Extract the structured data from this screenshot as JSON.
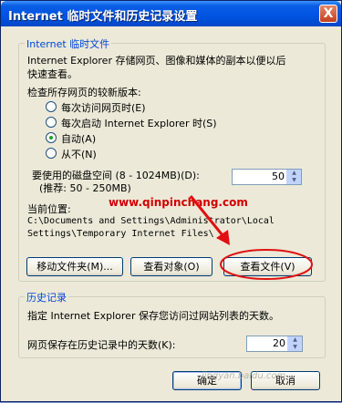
{
  "window": {
    "title": "Internet 临时文件和历史记录设置",
    "close_label": "X"
  },
  "temp_files": {
    "legend": "Internet 临时文件",
    "desc_line1": "Internet Explorer 存储网页、图像和媒体的副本以便以后",
    "desc_line2": "快速查看。",
    "check_label": "检查所存网页的较新版本:",
    "options": [
      {
        "label": "每次访问网页时(E)",
        "selected": false
      },
      {
        "label": "每次启动 Internet Explorer 时(S)",
        "selected": false
      },
      {
        "label": "自动(A)",
        "selected": true
      },
      {
        "label": "从不(N)",
        "selected": false
      }
    ],
    "disk_label_line1": "要使用的磁盘空间 (8 - 1024MB)(D):",
    "disk_label_line2": "(推荐: 50 - 250MB)",
    "disk_value": "50",
    "location_label": "当前位置:",
    "location_line1": "C:\\Documents and Settings\\Administrator\\Local",
    "location_line2": "Settings\\Temporary Internet Files\\",
    "buttons": {
      "move": "移动文件夹(M)...",
      "view_objects": "查看对象(O)",
      "view_files": "查看文件(V)"
    }
  },
  "history": {
    "legend": "历史记录",
    "desc": "指定 Internet Explorer 保存您访问过网站列表的天数。",
    "days_label": "网页保存在历史记录中的天数(K):",
    "days_value": "20"
  },
  "footer": {
    "ok": "确定",
    "cancel": "取消"
  },
  "watermark": {
    "url": "www.qinpinchang.com",
    "bottom": "jingyan.baidu.com"
  },
  "colors": {
    "title_bar": "#0054e3",
    "legend_text": "#0046d5",
    "annotation_red": "#e01010"
  }
}
